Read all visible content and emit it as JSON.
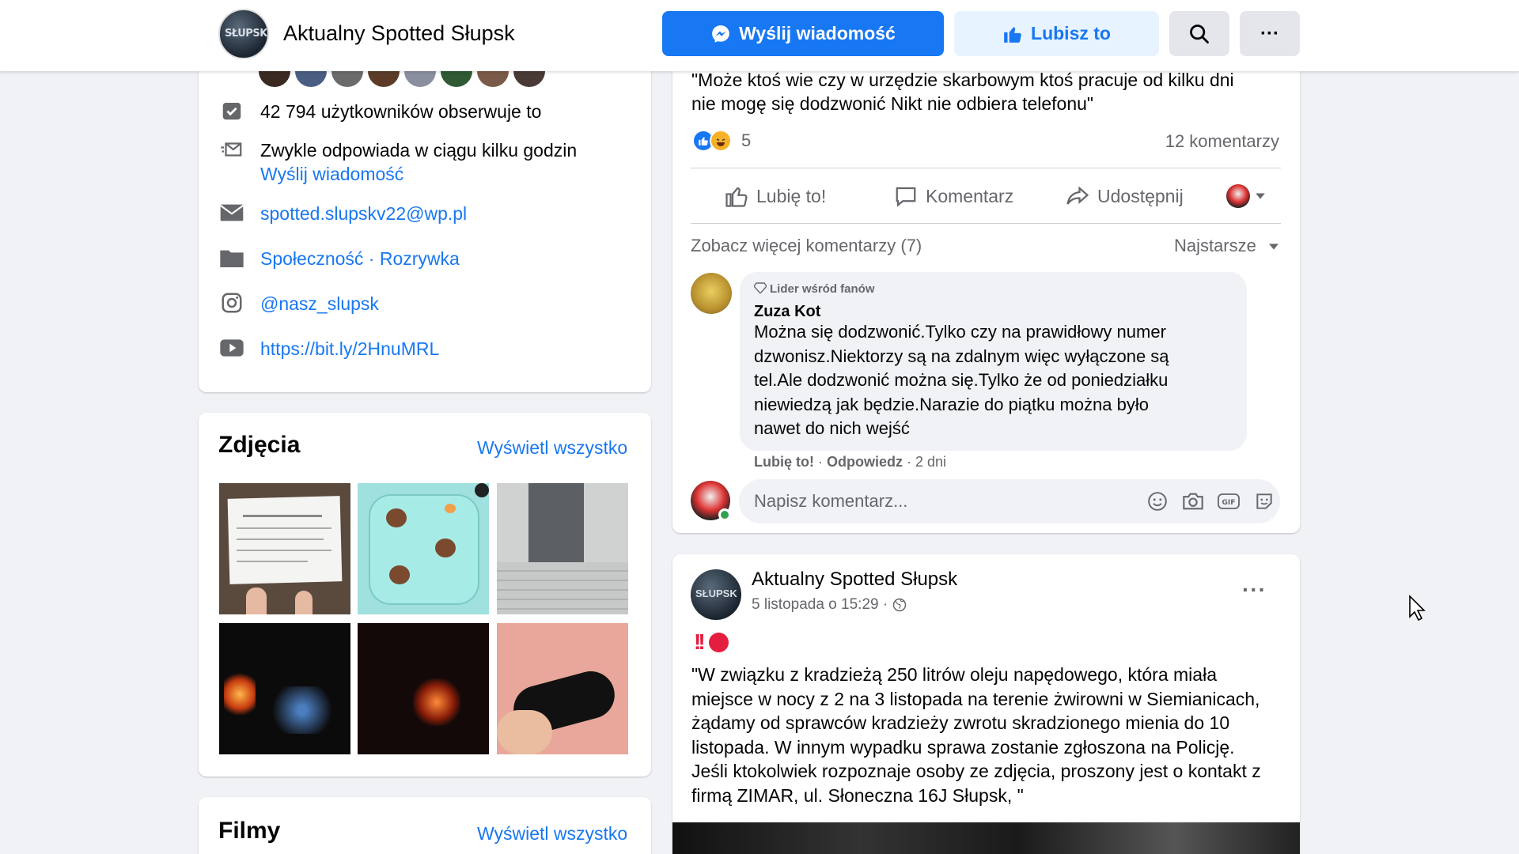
{
  "header": {
    "page_name": "Aktualny Spotted Słupsk",
    "avatar_text": "SŁUPSK",
    "message_button": "Wyślij wiadomość",
    "like_button": "Lubisz to",
    "more_button": "···"
  },
  "about": {
    "followers_text": "42 794 użytkowników obserwuje to",
    "response_time": "Zwykle odpowiada w ciągu kilku godzin",
    "send_message_link": "Wyślij wiadomość",
    "email": "spotted.slupskv22@wp.pl",
    "category_1": "Społeczność",
    "category_separator": " · ",
    "category_2": "Rozrywka",
    "instagram": "@nasz_slupsk",
    "website": "https://bit.ly/2HnuMRL"
  },
  "photos": {
    "title": "Zdjęcia",
    "see_all": "Wyświetl wszystko"
  },
  "films": {
    "title": "Filmy",
    "see_all": "Wyświetl wszystko"
  },
  "post1": {
    "text_line1": "\"Może ktoś wie czy w urzędzie skarbowym ktoś pracuje  od kilku dni",
    "text_line2": "nie mogę się dodzwonić  Nikt nie odbiera telefonu\"",
    "reaction_count": "5",
    "comments_count": "12 komentarzy",
    "like_action": "Lubię to!",
    "comment_action": "Komentarz",
    "share_action": "Udostępnij",
    "more_comments": "Zobacz więcej komentarzy (7)",
    "sort_label": "Najstarsze",
    "comment": {
      "badge": "Lider wśród fanów",
      "author": "Zuza Kot",
      "line1": "Można się dodzwonić.Tylko czy na prawidłowy numer",
      "line2": "dzwonisz.Niektorzy są na zdalnym więc wyłączone są",
      "line3": "tel.Ale dodzwonić można się.Tylko że od poniedziałku",
      "line4": "niewiedzą jak będzie.Narazie do piątku można było",
      "line5": "nawet do nich wejść",
      "like": "Lubię to!",
      "separator": " · ",
      "reply": "Odpowiedz",
      "time": " · 2 dni"
    },
    "comment_placeholder": "Napisz komentarz...",
    "gif_label": "GIF"
  },
  "post2": {
    "author": "Aktualny Spotted Słupsk",
    "avatar_text": "SŁUPSK",
    "date": "5 listopada o 15:29 ·",
    "more": "···",
    "bang": "!!",
    "text_line1": "\"W związku z kradzieżą 250 litrów oleju napędowego, która miała",
    "text_line2": "miejsce w nocy z 2 na 3 listopada na terenie żwirowni w Siemianicach,",
    "text_line3": "żądamy od sprawców kradzieży zwrotu skradzionego mienia do 10",
    "text_line4": "listopada. W innym wypadku sprawa zostanie zgłoszona na Policję.",
    "text_line5": "Jeśli ktokolwiek rozpoznaje osoby ze zdjęcia, proszony jest o kontakt z",
    "text_line6": "firmą ZIMAR, ul. Słoneczna 16J Słupsk, \""
  },
  "colors": {
    "brand_blue": "#1877f2",
    "background": "#f0f2f5",
    "secondary_text": "#65676b",
    "online_green": "#31a24c",
    "alert_red": "#e41e3f"
  }
}
